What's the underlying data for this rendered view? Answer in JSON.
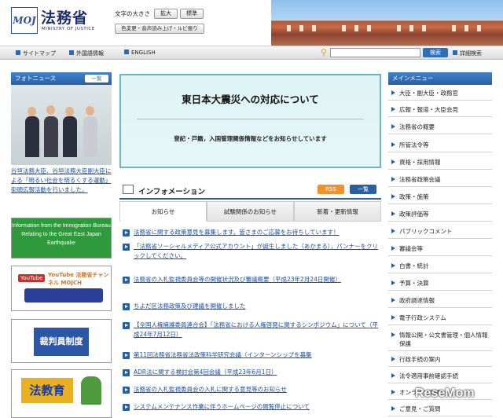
{
  "header": {
    "logo_mark": "MOJ",
    "title": "法務省",
    "subtitle": "MINISTRY OF JUSTICE",
    "font_size_label": "文字の大きさ",
    "enlarge": "拡大",
    "standard": "標準",
    "read_aloud": "色変更・音声読み上げ・ルビ振り"
  },
  "toolbar": {
    "sitemap": "サイトマップ",
    "foreign": "外国語情報",
    "english": "ENGLISH",
    "search_button": "検索",
    "advanced_search": "詳細検索"
  },
  "photo_news": {
    "heading": "フォトニュース",
    "more": "一覧",
    "caption": "谷垣法務大臣、谷垣法務大臣副大臣による「明るい社会を明るくする運動」街頭広報活動を行いました。"
  },
  "banners": {
    "earthquake": "Information from the Immigration Bureau Relating to the Great East Japan Earthquake",
    "youtube": "YouTube 法務省チャンネル MOJCH",
    "judge": "裁判員制度",
    "law_education": "法教育"
  },
  "main_banner": {
    "title": "東日本大震災への対応について",
    "sub": "登記・戸籍，入国管理関係情報などをお知らせしています"
  },
  "info": {
    "heading": "インフォメーション",
    "rss": "RSS",
    "more": "一覧",
    "tabs": [
      "お知らせ",
      "試験関係のお知らせ",
      "新着・更新情報"
    ],
    "items": [
      "法務省に関する政策意見を募集します。皆さまのご応募をお待ちしています！",
      "「法務省ソーシャルメディア公式アカウント」が誕生しました（あかまる），パンナーをクリックしてください。",
      "法務省の入札監視委員会等の開催状況及び審議概要（平成23年2月24日開催）",
      "ちよだ区法務政策及び建議を開催しました",
      "【全国人権擁護委員連合会】「法務省における人権啓発に関するシンポジウム」について（平成24年7月12日）",
      "第11回法務省法務省法政策科学研究会議（インターンシップを募集",
      "ADR法に関する検討会第4回会議（平成23年6月1日）",
      "法務省の入札監視委員会の入札に関する意見等のお知らせ",
      "システムメンテナンス作業に伴うホームページの閲覧停止について"
    ]
  },
  "main_menu": {
    "heading": "メインメニュー",
    "items": [
      "大臣・副大臣・政務官",
      "広報・報道・大臣会見",
      "法務省の概要",
      "所管法令等",
      "資格・採用情報",
      "法務省政策会議",
      "政策・施策",
      "政策評価等",
      "パブリックコメント",
      "審議会等",
      "白書・統計",
      "予算・決算",
      "政府調達情報",
      "電子行政システム",
      "情報公開・公文書管理・個人情報保護",
      "行政手続の案内",
      "法令適用事前確認手続",
      "オンライン申請",
      "ご意見・ご質問"
    ]
  },
  "watermark": "ReseMom"
}
